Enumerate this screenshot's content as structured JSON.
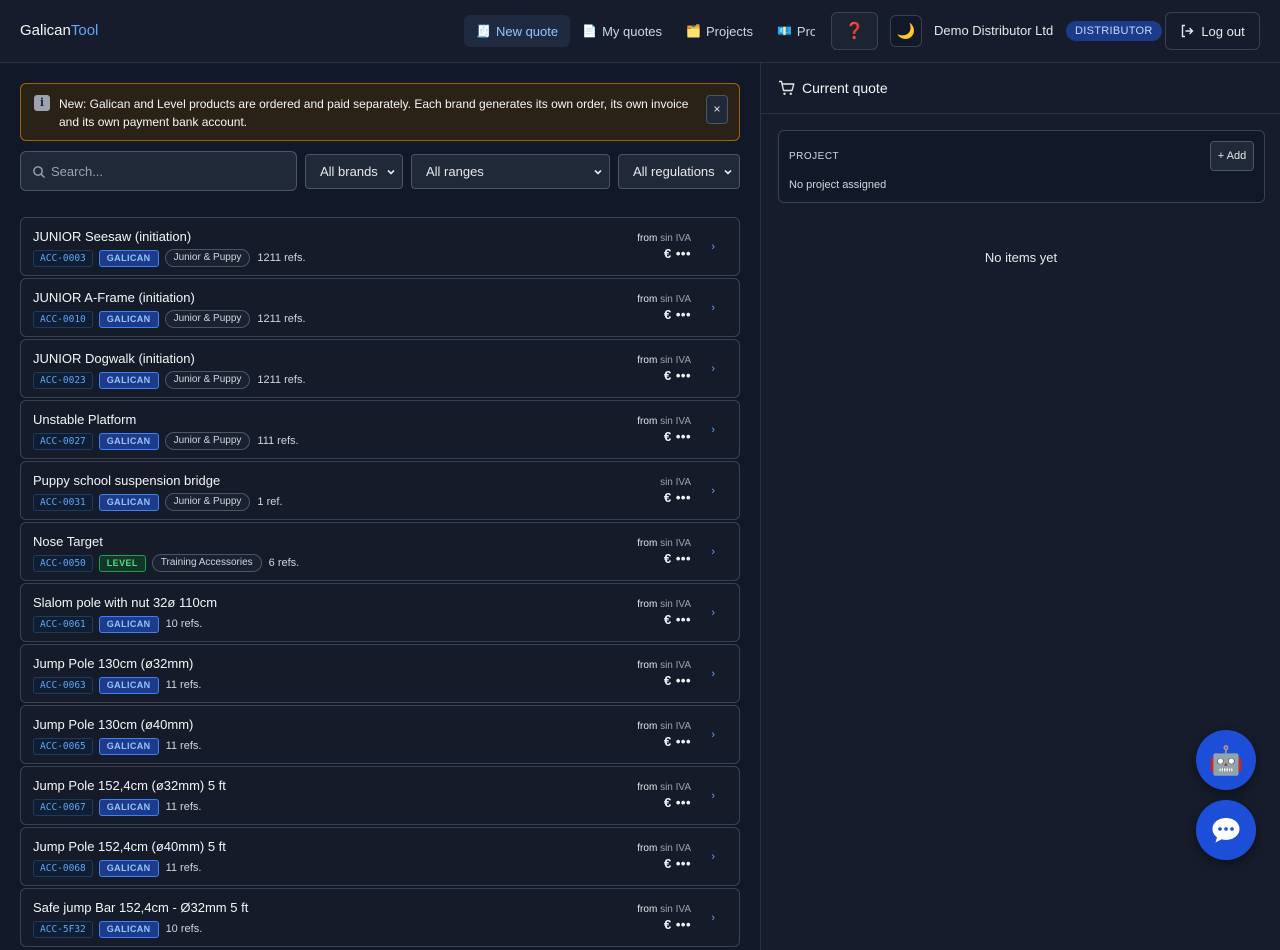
{
  "app": {
    "logo_primary": "Galican",
    "logo_secondary": "Tool"
  },
  "nav": {
    "items": [
      {
        "icon": "🧾",
        "label": "New quote",
        "active": true
      },
      {
        "icon": "📄",
        "label": "My quotes",
        "active": false
      },
      {
        "icon": "🗂️",
        "label": "Projects",
        "active": false
      },
      {
        "icon": "💶",
        "label": "Pro",
        "active": false
      }
    ],
    "help_icon": "❓",
    "theme_icon": "🌙",
    "org_name": "Demo Distributor Ltd",
    "role": "DISTRIBUTOR",
    "logout_label": "Log out"
  },
  "notice": {
    "text": "New: Galican and Level products are ordered and paid separately. Each brand generates its own order, its own invoice and its own payment bank account.",
    "close_label": "×"
  },
  "filters": {
    "search_placeholder": "Search...",
    "brand": "All brands",
    "range": "All ranges",
    "regulation": "All regulations"
  },
  "products": [
    {
      "name": "JUNIOR Seesaw (initiation)",
      "code": "ACC-0003",
      "brand": "GALICAN",
      "range": "Junior & Puppy",
      "refs": "1211 refs.",
      "from": "from",
      "tax": "sin IVA",
      "price": "€ •••"
    },
    {
      "name": "JUNIOR A-Frame (initiation)",
      "code": "ACC-0010",
      "brand": "GALICAN",
      "range": "Junior & Puppy",
      "refs": "1211 refs.",
      "from": "from",
      "tax": "sin IVA",
      "price": "€ •••"
    },
    {
      "name": "JUNIOR Dogwalk (initiation)",
      "code": "ACC-0023",
      "brand": "GALICAN",
      "range": "Junior & Puppy",
      "refs": "1211 refs.",
      "from": "from",
      "tax": "sin IVA",
      "price": "€ •••"
    },
    {
      "name": "Unstable Platform",
      "code": "ACC-0027",
      "brand": "GALICAN",
      "range": "Junior & Puppy",
      "refs": "111 refs.",
      "from": "from",
      "tax": "sin IVA",
      "price": "€ •••"
    },
    {
      "name": "Puppy school suspension bridge",
      "code": "ACC-0031",
      "brand": "GALICAN",
      "range": "Junior & Puppy",
      "refs": "1 ref.",
      "from": "",
      "tax": "sin IVA",
      "price": "€ •••"
    },
    {
      "name": "Nose Target",
      "code": "ACC-0050",
      "brand": "LEVEL",
      "range": "Training Accessories",
      "refs": "6 refs.",
      "from": "from",
      "tax": "sin IVA",
      "price": "€ •••"
    },
    {
      "name": "Slalom pole with nut 32ø 110cm",
      "code": "ACC-0061",
      "brand": "GALICAN",
      "range": "",
      "refs": "10 refs.",
      "from": "from",
      "tax": "sin IVA",
      "price": "€ •••"
    },
    {
      "name": "Jump Pole 130cm (ø32mm)",
      "code": "ACC-0063",
      "brand": "GALICAN",
      "range": "",
      "refs": "11 refs.",
      "from": "from",
      "tax": "sin IVA",
      "price": "€ •••"
    },
    {
      "name": "Jump Pole 130cm (ø40mm)",
      "code": "ACC-0065",
      "brand": "GALICAN",
      "range": "",
      "refs": "11 refs.",
      "from": "from",
      "tax": "sin IVA",
      "price": "€ •••"
    },
    {
      "name": "Jump Pole 152,4cm (ø32mm) 5 ft",
      "code": "ACC-0067",
      "brand": "GALICAN",
      "range": "",
      "refs": "11 refs.",
      "from": "from",
      "tax": "sin IVA",
      "price": "€ •••"
    },
    {
      "name": "Jump Pole 152,4cm (ø40mm) 5 ft",
      "code": "ACC-0068",
      "brand": "GALICAN",
      "range": "",
      "refs": "11 refs.",
      "from": "from",
      "tax": "sin IVA",
      "price": "€ •••"
    },
    {
      "name": "Safe jump Bar 152,4cm - Ø32mm 5 ft",
      "code": "ACC-5F32",
      "brand": "GALICAN",
      "range": "",
      "refs": "10 refs.",
      "from": "from",
      "tax": "sin IVA",
      "price": "€ •••"
    }
  ],
  "quote": {
    "title": "Current quote",
    "project_caption": "PROJECT",
    "project_value": "No project assigned",
    "add_label": "+ Add",
    "empty_text": "No items yet"
  },
  "fabs": {
    "bot_icon": "🤖",
    "chat_icon": "speech-bubble-icon"
  },
  "colors": {
    "accent": "#60a5fa",
    "galican": "#1e3a8a",
    "level": "#16a34a",
    "notice_border": "#a16207"
  }
}
